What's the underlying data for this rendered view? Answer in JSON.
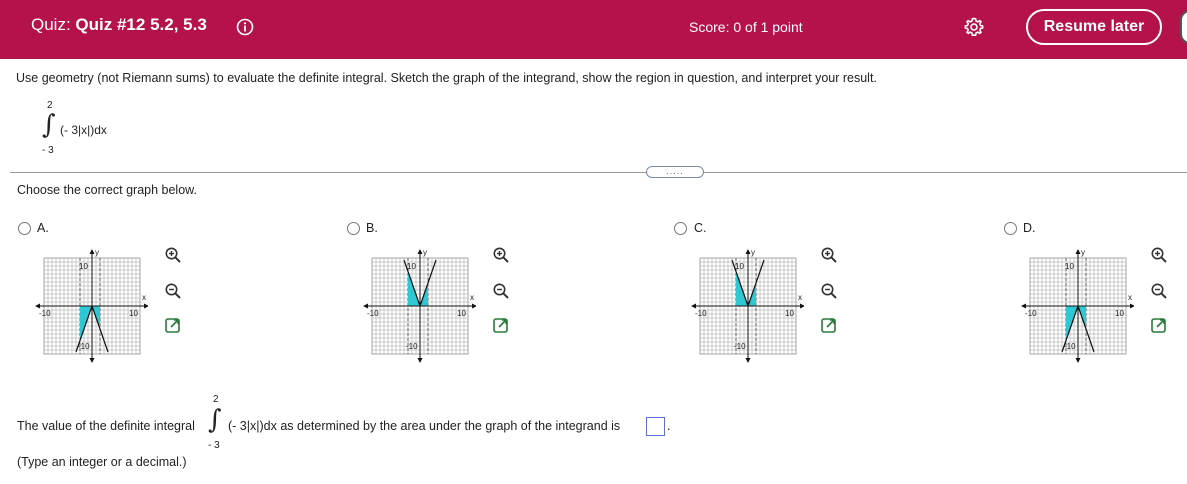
{
  "header": {
    "quiz_prefix": "Quiz:",
    "quiz_name": "Quiz #12 5.2, 5.3",
    "score": "Score: 0 of 1 point",
    "resume_label": "Resume later",
    "bg_color": "#b5114b"
  },
  "question": {
    "text": "Use geometry (not Riemann sums) to evaluate the definite integral. Sketch the graph of the integrand, show the region in question, and interpret your result.",
    "integral": {
      "upper": "2",
      "lower": "- 3",
      "integrand": "(- 3|x|)dx"
    },
    "more_label": "....."
  },
  "choose_text": "Choose the correct graph below.",
  "options": [
    {
      "label": "A.",
      "shape": "inverted-v-below",
      "x_axis_label": "x",
      "y_axis_label": "y",
      "tick_min": "-10",
      "tick_max": "10",
      "tick_top": "10",
      "tick_bottom": "-10"
    },
    {
      "label": "B.",
      "shape": "v-above",
      "x_axis_label": "x",
      "y_axis_label": "y",
      "tick_min": "-10",
      "tick_max": "10",
      "tick_top": "10",
      "tick_bottom": "-10"
    },
    {
      "label": "C.",
      "shape": "v-above-partial",
      "x_axis_label": "x",
      "y_axis_label": "y",
      "tick_min": "-10",
      "tick_max": "10",
      "tick_top": "10",
      "tick_bottom": "-10"
    },
    {
      "label": "D.",
      "shape": "inverted-v-below-partial",
      "x_axis_label": "x",
      "y_axis_label": "y",
      "tick_min": "-10",
      "tick_max": "10",
      "tick_top": "10",
      "tick_bottom": "-10"
    }
  ],
  "answer": {
    "prefix": "The value of the definite integral",
    "integral": {
      "upper": "2",
      "lower": "- 3",
      "integrand": "(- 3|x|)dx"
    },
    "suffix": "as determined by the area under the graph of the integrand is",
    "period": ".",
    "hint": "(Type an integer or a decimal.)",
    "value": ""
  },
  "colors": {
    "shade": "#2ec8d4",
    "grid": "#9a9a9a",
    "accent": "#b5114b"
  }
}
